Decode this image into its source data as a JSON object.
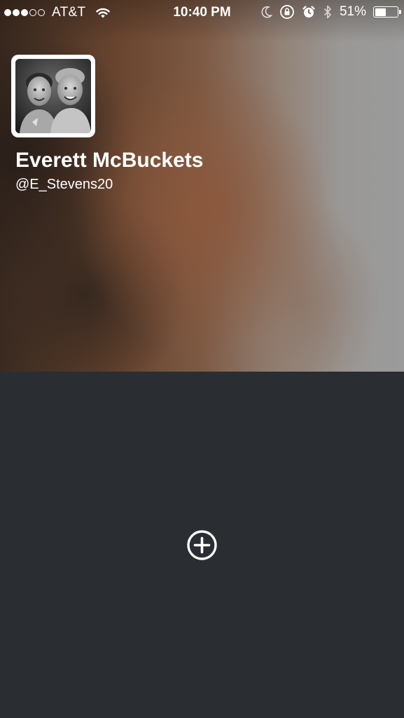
{
  "status_bar": {
    "signal_bars_filled": 3,
    "signal_bars_total": 5,
    "carrier": "AT&T",
    "time": "10:40 PM",
    "battery_percent": "51%",
    "battery_level": 0.51,
    "icons": [
      "wifi-icon",
      "moon-icon",
      "rotation-lock-icon",
      "alarm-icon",
      "bluetooth-icon",
      "battery-icon"
    ]
  },
  "profile": {
    "display_name": "Everett McBuckets",
    "handle": "@E_Stevens20"
  },
  "actions": {
    "add_icon": "plus-circle-icon"
  },
  "colors": {
    "lower_panel": "#2a2e33",
    "text": "#ffffff"
  }
}
